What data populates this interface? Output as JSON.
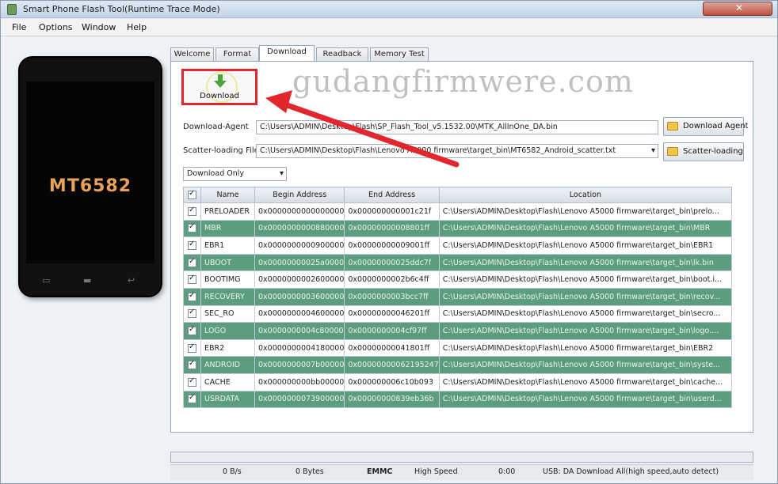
{
  "window": {
    "title": "Smart Phone Flash Tool(Runtime Trace Mode)",
    "close_color": "#c35040"
  },
  "menu": {
    "items": [
      "File",
      "Options",
      "Window",
      "Help"
    ]
  },
  "phone": {
    "model": "MT6582"
  },
  "tabs": [
    "Welcome",
    "Format",
    "Download",
    "Readback",
    "Memory Test"
  ],
  "active_tab": "Download",
  "download_button": {
    "label": "Download",
    "highlight_color": "#e1262d"
  },
  "watermark": "gudangfirmwere.com",
  "form": {
    "download_agent_label": "Download-Agent",
    "download_agent_value": "C:\\Users\\ADMIN\\Desktop\\Flash\\SP_Flash_Tool_v5.1532.00\\MTK_AllInOne_DA.bin",
    "download_agent_button": "Download Agent",
    "scatter_label": "Scatter-loading File",
    "scatter_value": "C:\\Users\\ADMIN\\Desktop\\Flash\\Lenovo A5000 firmware\\target_bin\\MT6582_Android_scatter.txt",
    "scatter_button": "Scatter-loading",
    "mode": "Download Only"
  },
  "table": {
    "headers": [
      "Name",
      "Begin Address",
      "End Address",
      "Location"
    ],
    "rows": [
      {
        "name": "PRELOADER",
        "begin": "0x0000000000000000",
        "end": "0x000000000001c21f",
        "location": "C:\\Users\\ADMIN\\Desktop\\Flash\\Lenovo A5000 firmware\\target_bin\\prelo...",
        "style": "white"
      },
      {
        "name": "MBR",
        "begin": "0x0000000000880000",
        "end": "0x00000000008801ff",
        "location": "C:\\Users\\ADMIN\\Desktop\\Flash\\Lenovo A5000 firmware\\target_bin\\MBR",
        "style": "green"
      },
      {
        "name": "EBR1",
        "begin": "0x0000000000900000",
        "end": "0x00000000009001ff",
        "location": "C:\\Users\\ADMIN\\Desktop\\Flash\\Lenovo A5000 firmware\\target_bin\\EBR1",
        "style": "white"
      },
      {
        "name": "UBOOT",
        "begin": "0x00000000025a0000",
        "end": "0x00000000025ddc7f",
        "location": "C:\\Users\\ADMIN\\Desktop\\Flash\\Lenovo A5000 firmware\\target_bin\\lk.bin",
        "style": "green"
      },
      {
        "name": "BOOTIMG",
        "begin": "0x0000000002600000",
        "end": "0x0000000002b6c4ff",
        "location": "C:\\Users\\ADMIN\\Desktop\\Flash\\Lenovo A5000 firmware\\target_bin\\boot.i...",
        "style": "white"
      },
      {
        "name": "RECOVERY",
        "begin": "0x0000000003600000",
        "end": "0x0000000003bcc7ff",
        "location": "C:\\Users\\ADMIN\\Desktop\\Flash\\Lenovo A5000 firmware\\target_bin\\recov...",
        "style": "green"
      },
      {
        "name": "SEC_RO",
        "begin": "0x0000000004600000",
        "end": "0x00000000046201ff",
        "location": "C:\\Users\\ADMIN\\Desktop\\Flash\\Lenovo A5000 firmware\\target_bin\\secro...",
        "style": "white"
      },
      {
        "name": "LOGO",
        "begin": "0x0000000004c80000",
        "end": "0x0000000004cf97ff",
        "location": "C:\\Users\\ADMIN\\Desktop\\Flash\\Lenovo A5000 firmware\\target_bin\\logo....",
        "style": "green"
      },
      {
        "name": "EBR2",
        "begin": "0x0000000004180000",
        "end": "0x00000000041801ff",
        "location": "C:\\Users\\ADMIN\\Desktop\\Flash\\Lenovo A5000 firmware\\target_bin\\EBR2",
        "style": "white"
      },
      {
        "name": "ANDROID",
        "begin": "0x0000000007b00000",
        "end": "0x00000000062195247",
        "location": "C:\\Users\\ADMIN\\Desktop\\Flash\\Lenovo A5000 firmware\\target_bin\\syste...",
        "style": "green"
      },
      {
        "name": "CACHE",
        "begin": "0x000000000bb00000",
        "end": "0x000000006c10b093",
        "location": "C:\\Users\\ADMIN\\Desktop\\Flash\\Lenovo A5000 firmware\\target_bin\\cache...",
        "style": "white"
      },
      {
        "name": "USRDATA",
        "begin": "0x0000000073900000",
        "end": "0x00000000839eb36b",
        "location": "C:\\Users\\ADMIN\\Desktop\\Flash\\Lenovo A5000 firmware\\target_bin\\userd...",
        "style": "green"
      }
    ]
  },
  "status": {
    "speed": "0 B/s",
    "bytes": "0 Bytes",
    "storage": "EMMC",
    "mode": "High Speed",
    "time": "0:00",
    "usb": "USB: DA Download All(high speed,auto detect)"
  },
  "colors": {
    "row_green": "#5c9d7f",
    "annotation_red": "#e1262d"
  }
}
